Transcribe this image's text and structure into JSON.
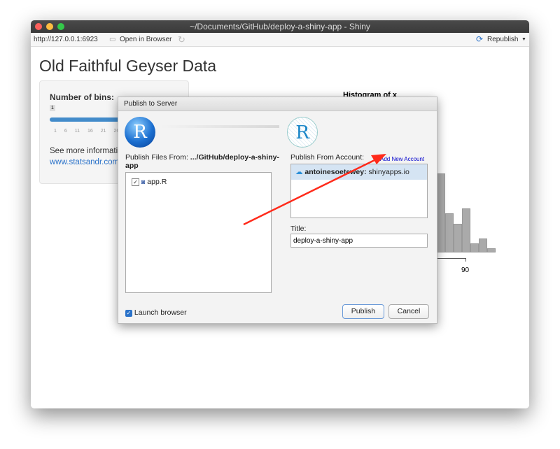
{
  "window": {
    "title": "~/Documents/GitHub/deploy-a-shiny-app - Shiny"
  },
  "toolbar": {
    "url": "http://127.0.0.1:6923",
    "open_browser": "Open in Browser",
    "republish": "Republish"
  },
  "app": {
    "title": "Old Faithful Geyser Data",
    "bins_label": "Number of bins:",
    "slider_value": "1",
    "slider_ticks": [
      "1",
      "6",
      "11",
      "16",
      "21",
      "26"
    ],
    "info_text": "See more informatio",
    "link": "www.statsandr.com",
    "plot_title": "Histogram of x",
    "axis_tick": "90"
  },
  "chart_data": {
    "type": "bar",
    "title": "Histogram of x",
    "visible_bar_heights_relative": [
      113,
      56,
      41,
      63,
      13,
      20,
      6
    ],
    "x_ticks": [
      "90"
    ]
  },
  "dialog": {
    "title": "Publish to Server",
    "files_from_label": "Publish Files From:",
    "files_from_path": ".../GitHub/deploy-a-shiny-app",
    "files": [
      {
        "name": "app.R",
        "checked": true
      }
    ],
    "account_label": "Publish From Account:",
    "add_account": "Add New Account",
    "account_name": "antoinesoetewey:",
    "account_server": "shinyapps.io",
    "title_label": "Title:",
    "title_value": "deploy-a-shiny-app",
    "launch_browser": "Launch browser",
    "launch_checked": true,
    "publish": "Publish",
    "cancel": "Cancel"
  },
  "colors": {
    "accent": "#2a72c9",
    "link": "#0000cc",
    "arrow": "#ff2a1a"
  }
}
